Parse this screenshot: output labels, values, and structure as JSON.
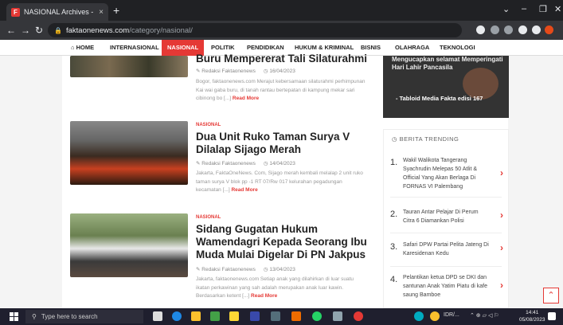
{
  "browser": {
    "tab_title": "NASIONAL Archives - FaktaOne!",
    "tab_close": "×",
    "new_tab": "+",
    "url_host": "faktaonenews.com",
    "url_path": "/category/nasional/",
    "min": "⌄",
    "minimize": "–",
    "restore": "❐",
    "close": "✕"
  },
  "sitenav": {
    "home": "HOME",
    "items": [
      "INTERNASIONAL",
      "NASIONAL",
      "POLITIK",
      "PENDIDIKAN",
      "HUKUM & KRIMINAL",
      "BISNIS",
      "OLAHRAGA",
      "TEKNOLOGI"
    ]
  },
  "articles": [
    {
      "title": "Buru Mempererat Tali Silaturahmi",
      "author": "Redaksi Faktaonenews",
      "date": "16/04/2023",
      "excerpt": "Bogor, faktaonenews.com Merajut kebersamaan silaturahmi perhimpunan Kai wai gaba buru, di tanah rantau bertepatan di kampung mekar sari cibinong bo [...]",
      "readmore": "Read More"
    },
    {
      "category": "NASIONAL",
      "title": "Dua Unit Ruko Taman Surya V Dilalap Sijago Merah",
      "author": "Redaksi Faktaonenews",
      "date": "14/04/2023",
      "excerpt": "Jakarta, FaktaOneNews. Com, Sijago merah kembali melalap 2 unit ruko taman surya V blok pp -1 RT 07/Rw 017 kelurahan pegadungan kecamatan [...]",
      "readmore": "Read More"
    },
    {
      "category": "NASIONAL",
      "title": "Sidang Gugatan Hukum Wamendagri Kepada Seorang Ibu Muda Mulai Digelar Di PN Jakpus",
      "author": "Redaksi Faktaonenews",
      "date": "13/04/2023",
      "excerpt": "Jakarta, faktaonenews.com Setiap anak yang dilahirkan di luar suatu ikatan perkawinan yang sah adalah merupakan anak luar kawin. Berdasarkan ketent [...]",
      "readmore": "Read More"
    }
  ],
  "sidebar": {
    "banner_top": "Mengucapkan selamat Memperingati Hari Lahir Pancasila",
    "banner_bottom": "- Tabloid Media Fakta edisi 167",
    "trending_head": "BERITA TRENDING",
    "trending": [
      {
        "num": "1.",
        "text": "Wakil Walikota Tangerang Syachrudin Melepas 50 Atlit & Official Yang Akan Berlaga Di FORNAS VI Palembang"
      },
      {
        "num": "2.",
        "text": "Tauran Antar Pelajar Di Perum Citra 6 Diamankan Polisi"
      },
      {
        "num": "3.",
        "text": "Safari DPW Partai Pelita Jateng Di Karesidenan Kedu"
      },
      {
        "num": "4.",
        "text": "Pelantikan ketua DPD se DKI dan santunan Anak Yatim Piatu di kafe saung Bamboe"
      }
    ]
  },
  "taskbar": {
    "search_placeholder": "Type here to search",
    "tray_text": "IDR/...",
    "time": "14:41",
    "date": "05/08/2023"
  }
}
